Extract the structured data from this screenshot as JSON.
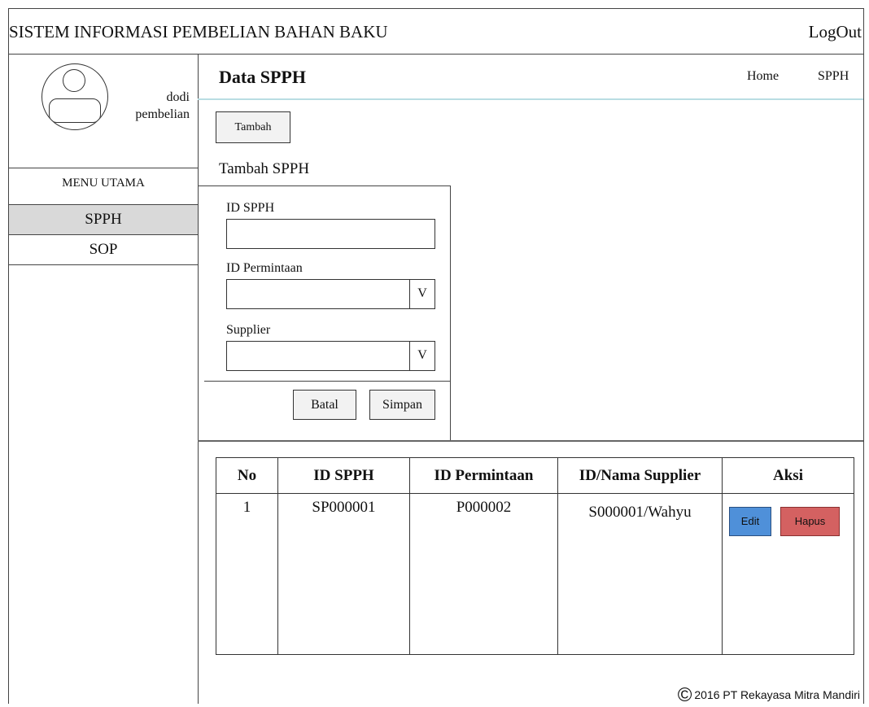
{
  "header": {
    "title": "SISTEM INFORMASI PEMBELIAN BAHAN BAKU",
    "logout_label": "LogOut"
  },
  "user": {
    "name": "dodi",
    "role": "pembelian"
  },
  "sidebar": {
    "menu_title": "MENU UTAMA",
    "items": [
      {
        "label": "SPPH",
        "active": true
      },
      {
        "label": "SOP",
        "active": false
      }
    ]
  },
  "page": {
    "title": "Data SPPH",
    "breadcrumb": [
      "Home",
      "SPPH"
    ],
    "add_button": "Tambah"
  },
  "form": {
    "title": "Tambah SPPH",
    "fields": [
      {
        "label": "ID SPPH",
        "value": "",
        "type": "text"
      },
      {
        "label": "ID Permintaan",
        "value": "",
        "type": "select"
      },
      {
        "label": "Supplier",
        "value": "",
        "type": "select"
      }
    ],
    "dropdown_arrow": "V",
    "cancel_label": "Batal",
    "save_label": "Simpan"
  },
  "table": {
    "columns": [
      "No",
      "ID SPPH",
      "ID Permintaan",
      "ID/Nama Supplier",
      "Aksi"
    ],
    "rows": [
      {
        "no": "1",
        "id_spph": "SP000001",
        "id_permintaan": "P000002",
        "supplier": "S000001/Wahyu"
      }
    ],
    "edit_label": "Edit",
    "delete_label": "Hapus"
  },
  "footer": {
    "symbol": "©",
    "text": "2016 PT Rekayasa Mitra Mandiri"
  },
  "colors": {
    "edit_button": "#4f90d9",
    "delete_button": "#d46161",
    "active_menu": "#d9d9d9",
    "title_underline": "#b9dde3"
  }
}
